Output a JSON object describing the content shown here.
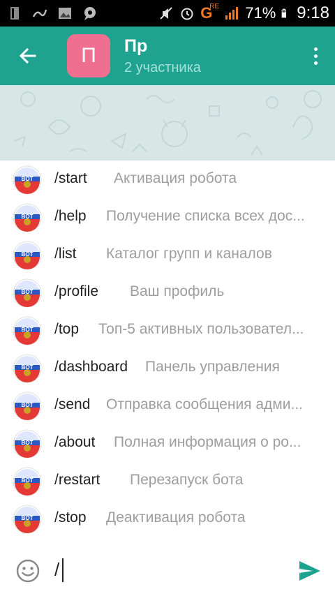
{
  "status_bar": {
    "battery_percent": "71%",
    "time": "9:18",
    "network_label": "G",
    "network_sub": "RE",
    "icons": [
      "sim-icon",
      "signal-wave-icon",
      "gallery-icon",
      "chat-bubble-icon",
      "mute-icon",
      "alarm-icon",
      "cell-signal-icon",
      "battery-icon"
    ]
  },
  "toolbar": {
    "avatar_letter": "П",
    "title": "Пр",
    "subtitle": "2 участника",
    "colors": {
      "bar": "#1fa390",
      "avatar": "#ee6f8f",
      "subtitle": "#a6e2d8"
    }
  },
  "commands": [
    {
      "name": "/start",
      "description": "Активация робота"
    },
    {
      "name": "/help",
      "description": "Получение списка всех дос..."
    },
    {
      "name": "/list",
      "description": "Каталог групп и каналов"
    },
    {
      "name": "/profile",
      "description": "Ваш профиль"
    },
    {
      "name": "/top",
      "description": "Топ-5 активных пользовател..."
    },
    {
      "name": "/dashboard",
      "description": "Панель управления"
    },
    {
      "name": "/send",
      "description": "Отправка сообщения адми..."
    },
    {
      "name": "/about",
      "description": "Полная информация о ро..."
    },
    {
      "name": "/restart",
      "description": "Перезапуск бота"
    },
    {
      "name": "/stop",
      "description": "Деактивация робота"
    }
  ],
  "input": {
    "value": "/",
    "accent": "#1fa390"
  }
}
